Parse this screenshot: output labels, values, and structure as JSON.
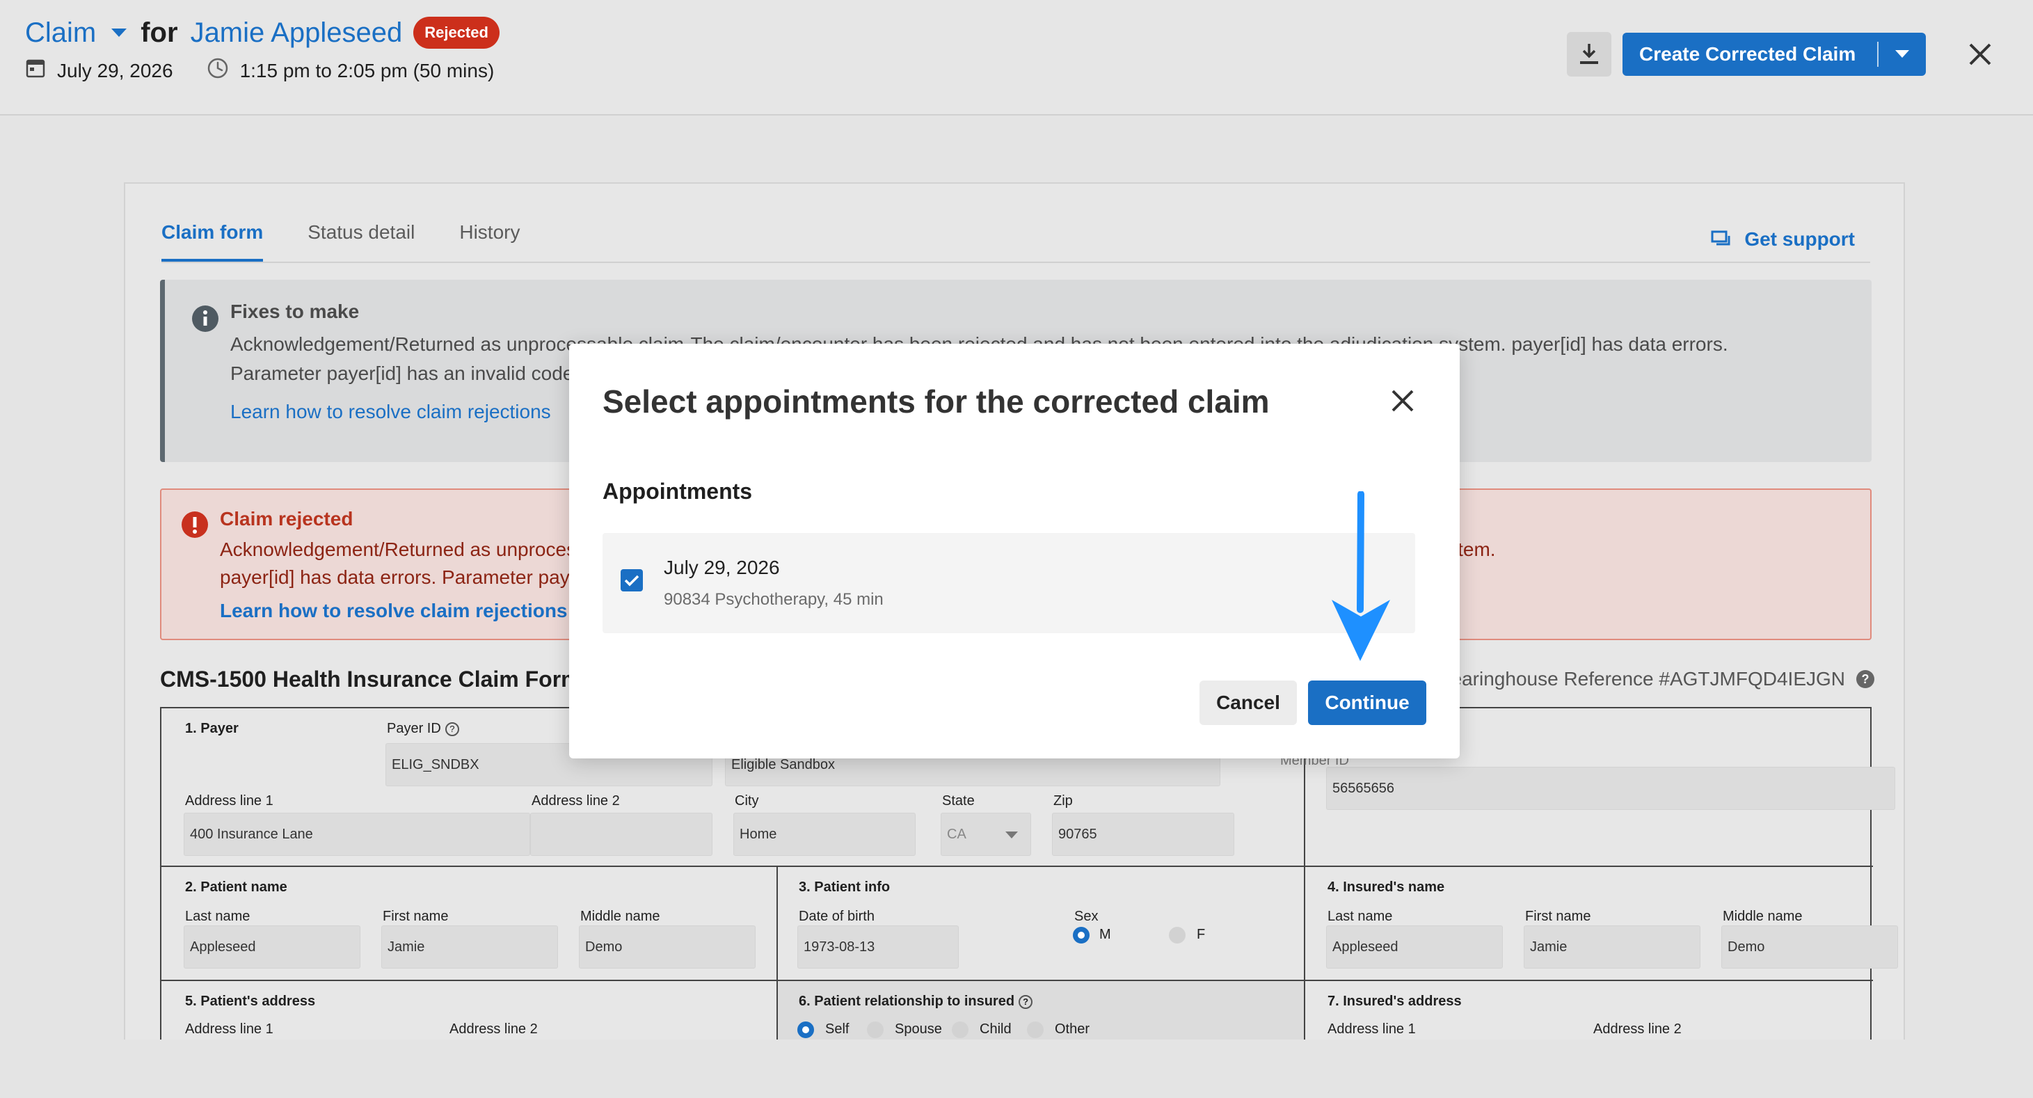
{
  "header": {
    "title_claim": "Claim",
    "title_for": "for",
    "patient_name": "Jamie Appleseed",
    "status_badge": "Rejected",
    "date": "July 29, 2026",
    "time": "1:15 pm to 2:05 pm (50 mins)",
    "primary_action": "Create Corrected Claim"
  },
  "tabs": [
    {
      "label": "Claim form",
      "active": true
    },
    {
      "label": "Status detail",
      "active": false
    },
    {
      "label": "History",
      "active": false
    }
  ],
  "support_label": "Get support",
  "fixes": {
    "title": "Fixes to make",
    "text_line1": "Acknowledgement/Returned as unprocessable claim-The claim/encounter has been rejected and has not been entered into the adjudication system. payer[id] has data errors.",
    "text_line2": "Parameter payer[id] has an invalid code.",
    "link": "Learn how to resolve claim rejections"
  },
  "rejected": {
    "title": "Claim rejected",
    "text_line1": "Acknowledgement/Returned as unprocessable claim-The claim/encounter has been rejected and has not been entered into the adjudication system.",
    "text_line2": "payer[id] has data errors. Parameter payer[id] has an invalid code.",
    "link": "Learn how to resolve claim rejections"
  },
  "cms": {
    "title": "CMS-1500 Health Insurance Claim Form",
    "reference": "Clearinghouse Reference #AGTJMFQD4IEJGN"
  },
  "form": {
    "payer": {
      "section": "1. Payer",
      "payer_id_label": "Payer ID",
      "payer_id": "ELIG_SNDBX",
      "payer_name": "Eligible Sandbox",
      "address1_label": "Address line 1",
      "address1": "400 Insurance Lane",
      "address2_label": "Address line 2",
      "address2": "",
      "city_label": "City",
      "city": "Home",
      "state_label": "State",
      "state": "CA",
      "zip_label": "Zip",
      "zip": "90765"
    },
    "member": {
      "member_id_label": "Member ID",
      "member_id": "56565656"
    },
    "patient_name": {
      "section": "2. Patient name",
      "last_label": "Last name",
      "last": "Appleseed",
      "first_label": "First name",
      "first": "Jamie",
      "middle_label": "Middle name",
      "middle": "Demo"
    },
    "patient_info": {
      "section": "3. Patient info",
      "dob_label": "Date of birth",
      "dob": "1973-08-13",
      "sex_label": "Sex",
      "sex_m": "M",
      "sex_f": "F"
    },
    "insured_name": {
      "section": "4. Insured's name",
      "last_label": "Last name",
      "last": "Appleseed",
      "first_label": "First name",
      "first": "Jamie",
      "middle_label": "Middle name",
      "middle": "Demo"
    },
    "patient_address": {
      "section": "5. Patient's address",
      "address1_label": "Address line 1",
      "address2_label": "Address line 2"
    },
    "relationship": {
      "section": "6. Patient relationship to insured",
      "options": [
        "Self",
        "Spouse",
        "Child",
        "Other"
      ]
    },
    "insured_address": {
      "section": "7. Insured's address",
      "address1_label": "Address line 1",
      "address2_label": "Address line 2"
    }
  },
  "modal": {
    "title": "Select appointments for the corrected claim",
    "appointments_header": "Appointments",
    "appointment": {
      "date": "July 29, 2026",
      "description": "90834 Psychotherapy, 45 min",
      "checked": true
    },
    "cancel_label": "Cancel",
    "continue_label": "Continue"
  },
  "colors": {
    "accent": "#1a6fc4",
    "rejected": "#cc2f1b",
    "arrow": "#1e90ff"
  }
}
